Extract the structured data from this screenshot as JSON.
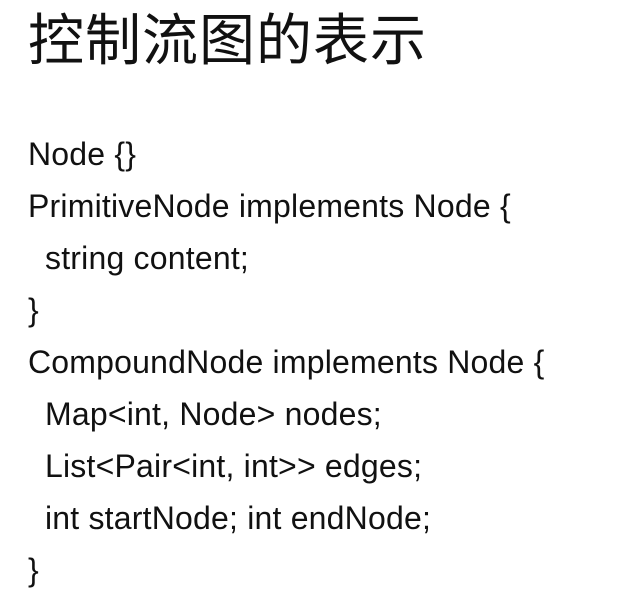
{
  "slide": {
    "title": "控制流图的表示",
    "code_lines": [
      {
        "text": "Node {}",
        "indent": false
      },
      {
        "text": "PrimitiveNode implements Node {",
        "indent": false
      },
      {
        "text": "string content;",
        "indent": true
      },
      {
        "text": "}",
        "indent": false
      },
      {
        "text": "CompoundNode implements Node {",
        "indent": false
      },
      {
        "text": "Map<int, Node> nodes;",
        "indent": true
      },
      {
        "text": "List<Pair<int, int>> edges;",
        "indent": true
      },
      {
        "text": "int startNode; int endNode;",
        "indent": true
      },
      {
        "text": "}",
        "indent": false
      }
    ]
  }
}
